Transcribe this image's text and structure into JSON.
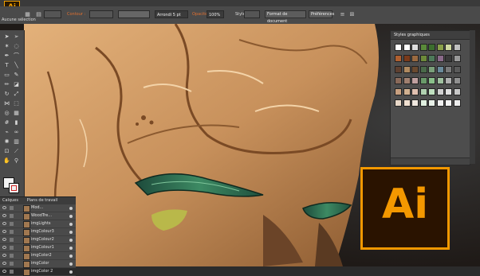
{
  "app": {
    "logo_text": "Ai",
    "big_logo_text": "Ai"
  },
  "control_bar": {
    "selection_label": "Aucune sélection",
    "stroke_label": "Contour :",
    "stroke_value": "",
    "brush_value": "Arrondi 5 pt",
    "opacity_label": "Opacité :",
    "opacity_value": "100%",
    "style_label": "Style :",
    "doc_format_button": "Format de document",
    "preferences_button": "Préférences"
  },
  "panels": {
    "styles_title": "Styles graphiques",
    "layers_tab": "Calques",
    "artboards_tab": "Plans de travail"
  },
  "layers": [
    {
      "name": "Mod..."
    },
    {
      "name": "WoodTre..."
    },
    {
      "name": "imgLights"
    },
    {
      "name": "imgColour3"
    },
    {
      "name": "imgColour2"
    },
    {
      "name": "imgColour1"
    },
    {
      "name": "imgColor2"
    },
    {
      "name": "imgColor"
    },
    {
      "name": "imgColor 2"
    }
  ],
  "colors": {
    "accent": "#f39800",
    "wood": "#c8915c",
    "wood_dark": "#7a4a25",
    "leaf": "#2f6b4f",
    "stroke_red": "#cc2222"
  }
}
